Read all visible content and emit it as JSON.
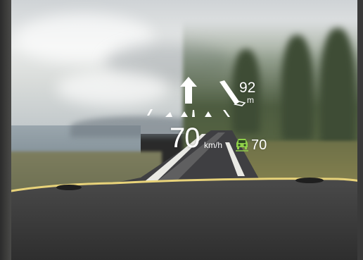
{
  "hud": {
    "current_speed": "70",
    "speed_unit": "km/h",
    "speed_limit": "70",
    "turn_distance": "92",
    "turn_distance_unit": "m"
  },
  "icons": {
    "straight_arrow": "straight-arrow-icon",
    "turn_indicator": "slight-right-turn-icon",
    "speed_limit_indicator": "speed-limit-vehicle-icon",
    "lane_markers": "lane-guidance-icon"
  },
  "colors": {
    "hud_text": "#ffffff",
    "limit_icon": "#8fd04a",
    "dashboard": "#3b3b3b",
    "dashboard_trim": "#e8d37a"
  }
}
